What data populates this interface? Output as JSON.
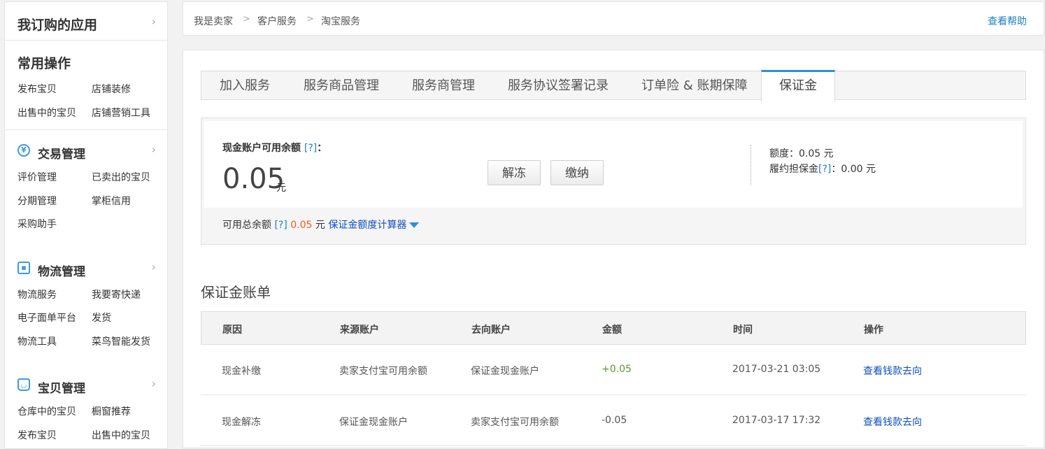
{
  "sidebar": {
    "title": "我订购的应用",
    "common": {
      "title": "常用操作",
      "items": [
        "发布宝贝",
        "店铺装修",
        "出售中的宝贝",
        "店铺营销工具"
      ]
    },
    "sections": [
      {
        "title": "交易管理",
        "icon": "yen-icon",
        "items": [
          "评价管理",
          "已卖出的宝贝",
          "分期管理",
          "掌柜信用",
          "采购助手"
        ]
      },
      {
        "title": "物流管理",
        "icon": "truck-icon",
        "items": [
          "物流服务",
          "我要寄快递",
          "电子面单平台",
          "发货",
          "物流工具",
          "菜鸟智能发货"
        ]
      },
      {
        "title": "宝贝管理",
        "icon": "bag-icon",
        "items": [
          "仓库中的宝贝",
          "橱窗推荐",
          "发布宝贝",
          "出售中的宝贝"
        ]
      }
    ]
  },
  "breadcrumb": [
    "我是卖家",
    "客户服务",
    "淘宝服务"
  ],
  "help_label": "查看帮助",
  "tabs": [
    "加入服务",
    "服务商品管理",
    "服务商管理",
    "服务协议签署记录",
    "订单险 & 账期保障",
    "保证金"
  ],
  "active_tab": "保证金",
  "balance": {
    "label": "现金账户可用余额",
    "help": "[?]",
    "colon": "：",
    "amount": "0.05",
    "unit": "元",
    "buttons": {
      "unfreeze": "解冻",
      "pay": "缴纳"
    },
    "quota": "额度：0.05 元",
    "guarantee_label": "履约担保金",
    "guarantee_value": "：0.00 元",
    "total_label": "可用总余额",
    "total_value": "0.05",
    "total_unit": "元",
    "calculator": "保证金额度计算器"
  },
  "ledger": {
    "title": "保证金账单",
    "columns": [
      "原因",
      "来源账户",
      "去向账户",
      "金额",
      "时间",
      "操作"
    ],
    "rows": [
      {
        "reason": "现金补缴",
        "from": "卖家支付宝可用余额",
        "to": "保证金现金账户",
        "amount": "+0.05",
        "time": "2017-03-21 03:05",
        "action": "查看钱款去向"
      },
      {
        "reason": "现金解冻",
        "from": "保证金现金账户",
        "to": "卖家支付宝可用余额",
        "amount": "-0.05",
        "time": "2017-03-17 17:32",
        "action": "查看钱款去向"
      }
    ]
  },
  "colors": {
    "accent": "#2e8fd6",
    "link": "#0d4fc1",
    "positive": "#5a9a2a",
    "negative": "#f25a23"
  }
}
